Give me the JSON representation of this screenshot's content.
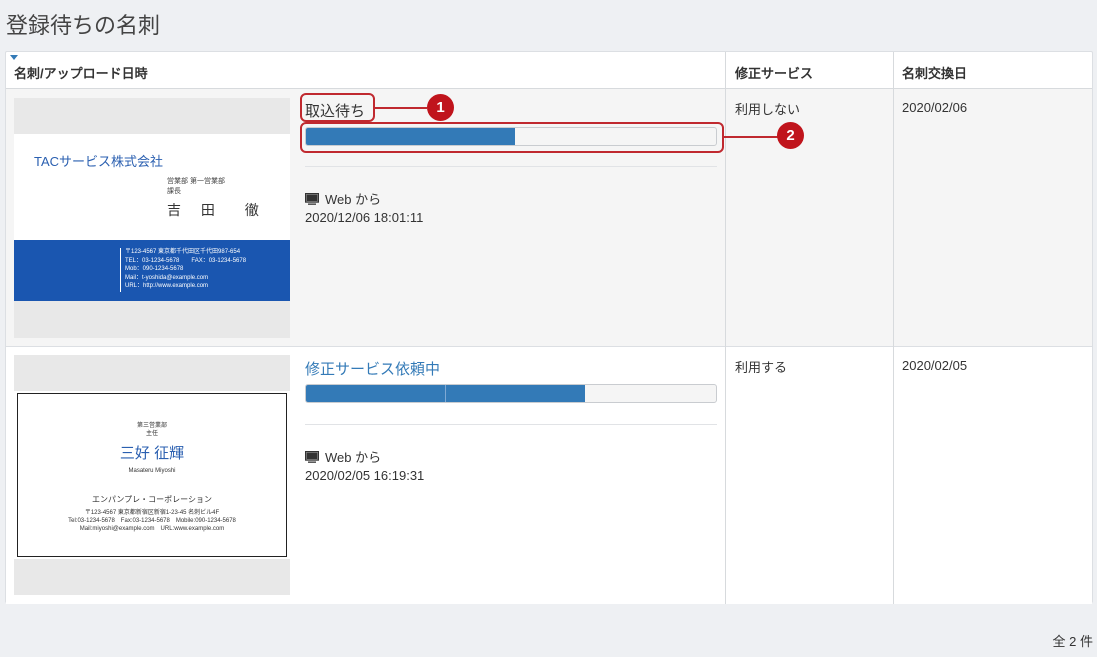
{
  "page": {
    "title": "登録待ちの名刺"
  },
  "table": {
    "headers": {
      "card_upload": "名刺/アップロード日時",
      "correction_service": "修正サービス",
      "exchange_date": "名刺交換日"
    },
    "rows": [
      {
        "status": "取込待ち",
        "progress": 0.51,
        "source": "Web から",
        "uploaded_at": "2020/12/06 18:01:11",
        "service": "利用しない",
        "exchange_date": "2020/02/06",
        "card": {
          "company": "TACサービス株式会社",
          "dept": "営業部 第一営業部",
          "role": "課長",
          "name": "吉 田　徹",
          "info": "〒123-4567 東京都千代田区千代田987-654\nTEL：03-1234-5678　　FAX：03-1234-5678\nMob：090-1234-5678\nMail：t-yoshida@example.com\nURL：http://www.example.com"
        }
      },
      {
        "status": "修正サービス依頼中",
        "progress": 0.68,
        "source": "Web から",
        "uploaded_at": "2020/02/05 16:19:31",
        "service": "利用する",
        "exchange_date": "2020/02/05",
        "card": {
          "dept": "第三営業部",
          "role": "主任",
          "name": "三好 征輝",
          "roman": "Masateru Miyoshi",
          "company": "エンパンプレ・コーポレーション",
          "info": "〒123-4567 東京都新宿区新宿1-23-45 名刺ビル4F\nTel:03-1234-5678　Fax:03-1234-5678　Mobile:090-1234-5678\nMail:miyoshi@example.com　URL:www.example.com"
        }
      }
    ]
  },
  "callouts": [
    "1",
    "2"
  ],
  "footer": {
    "total": "全 2 件"
  },
  "colors": {
    "accent": "#337ab7",
    "callout": "#c0141c",
    "card_band": "#1a56b0"
  },
  "icons": {
    "monitor": "monitor-icon",
    "sort": "sort-caret-icon"
  }
}
